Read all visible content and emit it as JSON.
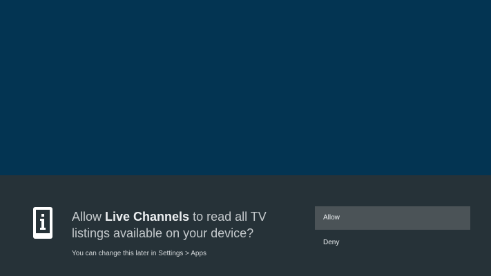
{
  "background": {
    "color": "#033452"
  },
  "dialog": {
    "background_color": "#263238",
    "icon": "device-info-icon",
    "message": {
      "prefix": "Allow ",
      "app_name": "Live Channels",
      "suffix": " to read all TV listings available on your device?"
    },
    "hint": "You can change this later in Settings > Apps",
    "options": [
      {
        "label": "Allow",
        "focused": true
      },
      {
        "label": "Deny",
        "focused": false
      }
    ],
    "focus_color": "#4b5357"
  }
}
